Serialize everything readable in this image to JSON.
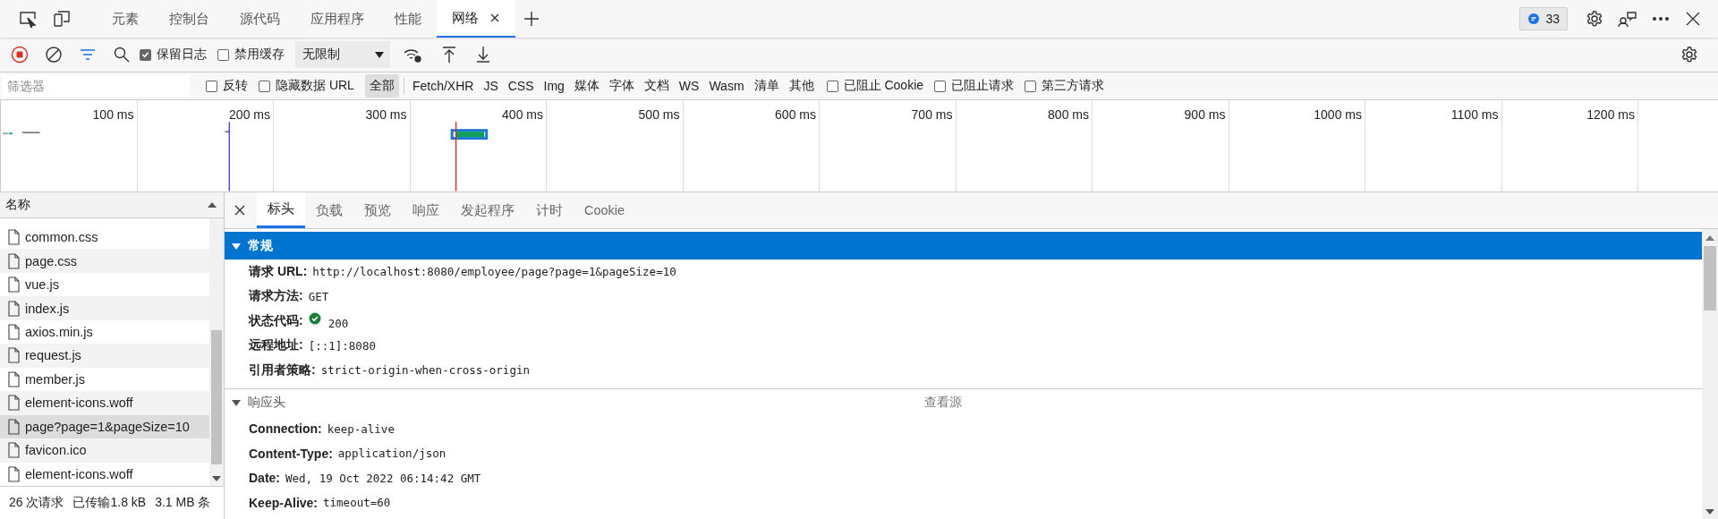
{
  "main_tabs": [
    {
      "label": "元素",
      "selected": false,
      "closable": false
    },
    {
      "label": "控制台",
      "selected": false,
      "closable": false
    },
    {
      "label": "源代码",
      "selected": false,
      "closable": false
    },
    {
      "label": "应用程序",
      "selected": false,
      "closable": false
    },
    {
      "label": "性能",
      "selected": false,
      "closable": false
    },
    {
      "label": "网络",
      "selected": true,
      "closable": true
    }
  ],
  "issues_badge": "33",
  "toolbar": {
    "recording": true,
    "options": [
      {
        "label": "保留日志",
        "checked": true
      },
      {
        "label": "禁用缓存",
        "checked": false
      }
    ],
    "throttling": "无限制"
  },
  "filter": {
    "placeholder": "筛选器",
    "options": [
      {
        "label": "反转",
        "checked": false
      },
      {
        "label": "隐藏数据 URL",
        "checked": false
      }
    ],
    "types": [
      {
        "label": "全部",
        "selected": true
      },
      {
        "label": "Fetch/XHR",
        "selected": false
      },
      {
        "label": "JS",
        "selected": false
      },
      {
        "label": "CSS",
        "selected": false
      },
      {
        "label": "Img",
        "selected": false
      },
      {
        "label": "媒体",
        "selected": false
      },
      {
        "label": "字体",
        "selected": false
      },
      {
        "label": "文档",
        "selected": false
      },
      {
        "label": "WS",
        "selected": false
      },
      {
        "label": "Wasm",
        "selected": false
      },
      {
        "label": "清单",
        "selected": false
      },
      {
        "label": "其他",
        "selected": false
      }
    ],
    "blocking": [
      {
        "label": "已阻止 Cookie",
        "checked": false
      },
      {
        "label": "已阻止请求",
        "checked": false
      },
      {
        "label": "第三方请求",
        "checked": false
      }
    ]
  },
  "timeline": {
    "ticks": [
      "100 ms",
      "200 ms",
      "300 ms",
      "400 ms",
      "500 ms",
      "600 ms",
      "700 ms",
      "800 ms",
      "900 ms",
      "1000 ms",
      "1100 ms",
      "1200 ms"
    ]
  },
  "requests": {
    "column": "名称",
    "rows": [
      {
        "name": "common.css",
        "selected": false
      },
      {
        "name": "page.css",
        "selected": false
      },
      {
        "name": "vue.js",
        "selected": false
      },
      {
        "name": "index.js",
        "selected": false
      },
      {
        "name": "axios.min.js",
        "selected": false
      },
      {
        "name": "request.js",
        "selected": false
      },
      {
        "name": "member.js",
        "selected": false
      },
      {
        "name": "element-icons.woff",
        "selected": false
      },
      {
        "name": "page?page=1&pageSize=10",
        "selected": true
      },
      {
        "name": "favicon.ico",
        "selected": false
      },
      {
        "name": "element-icons.woff",
        "selected": false
      }
    ]
  },
  "status_bar": [
    "26 次请求",
    "已传输1.8 kB",
    "3.1 MB 条"
  ],
  "details": {
    "tabs": [
      {
        "label": "标头",
        "selected": true
      },
      {
        "label": "负载",
        "selected": false
      },
      {
        "label": "预览",
        "selected": false
      },
      {
        "label": "响应",
        "selected": false
      },
      {
        "label": "发起程序",
        "selected": false
      },
      {
        "label": "计时",
        "selected": false
      },
      {
        "label": "Cookie",
        "selected": false
      }
    ],
    "sections": [
      {
        "title": "常规",
        "selected": true,
        "expanded": true,
        "rows": [
          {
            "kind": "text",
            "name": "请求 URL:",
            "value": "http://localhost:8080/employee/page?page=1&pageSize=10"
          },
          {
            "kind": "text",
            "name": "请求方法:",
            "value": "GET"
          },
          {
            "kind": "status",
            "name": "状态代码:",
            "value": "200"
          },
          {
            "kind": "text",
            "name": "远程地址:",
            "value": "[::1]:8080"
          },
          {
            "kind": "text",
            "name": "引用者策略:",
            "value": "strict-origin-when-cross-origin"
          }
        ]
      },
      {
        "title": "响应头",
        "selected": false,
        "expanded": true,
        "action": "查看源",
        "rows": [
          {
            "kind": "text",
            "name": "Connection:",
            "value": "keep-alive"
          },
          {
            "kind": "text",
            "name": "Content-Type:",
            "value": "application/json"
          },
          {
            "kind": "text",
            "name": "Date:",
            "value": "Wed, 19 Oct 2022 06:14:42 GMT"
          },
          {
            "kind": "text",
            "name": "Keep-Alive:",
            "value": "timeout=60"
          }
        ]
      }
    ]
  }
}
